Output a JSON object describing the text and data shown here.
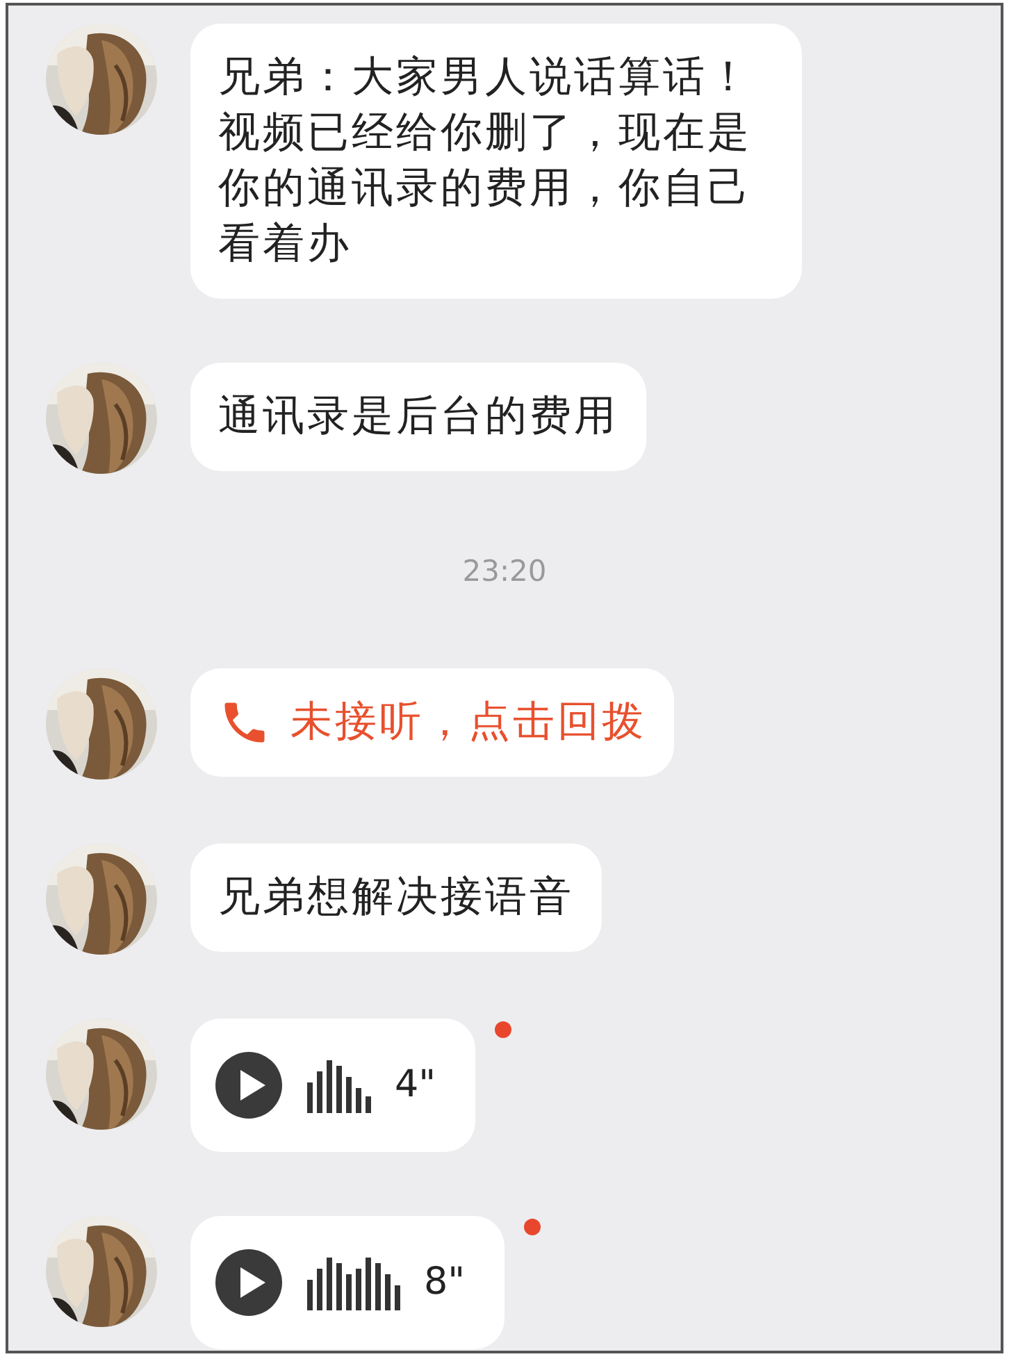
{
  "messages": [
    {
      "kind": "text",
      "text": "兄弟：大家男人说话算话！视频已经给你删了，现在是你的通讯录的费用，你自己看着办"
    },
    {
      "kind": "text",
      "text": "通讯录是后台的费用"
    },
    {
      "kind": "time",
      "text": "23:20"
    },
    {
      "kind": "call",
      "text": "未接听，点击回拨"
    },
    {
      "kind": "text",
      "text": "兄弟想解决接语音"
    },
    {
      "kind": "voice",
      "duration": "4\"",
      "unread": true
    },
    {
      "kind": "voice",
      "duration": "8\"",
      "unread": true
    }
  ]
}
